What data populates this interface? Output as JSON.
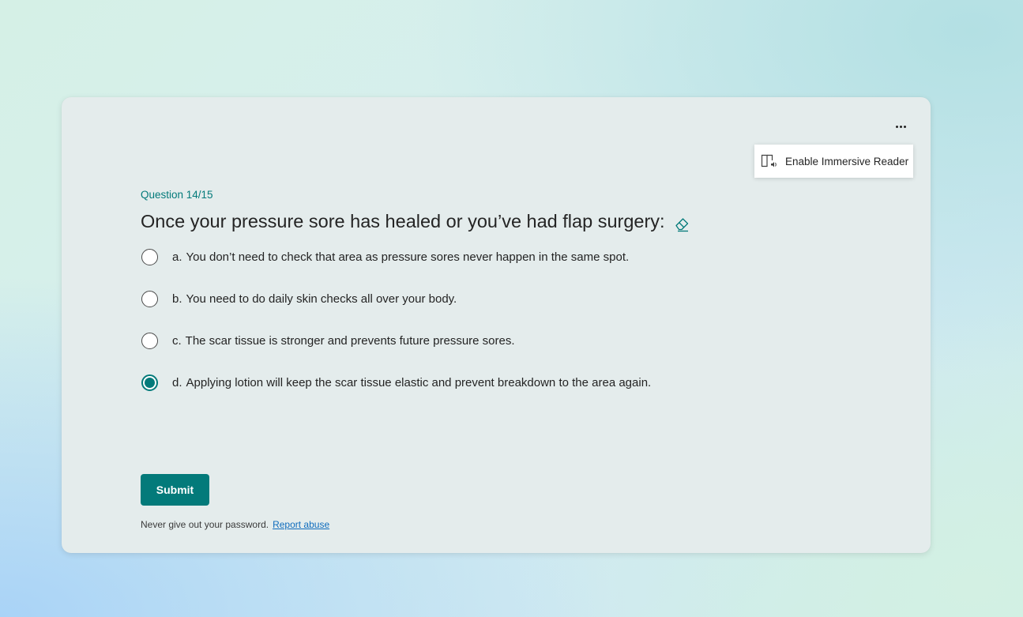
{
  "menu": {
    "more_icon": "more-horizontal-icon"
  },
  "immersive_reader": {
    "label": "Enable Immersive Reader",
    "icon": "immersive-reader-icon"
  },
  "question": {
    "number": "Question 14/15",
    "title": "Once your pressure sore has healed or you’ve had flap surgery:",
    "title_icon": "eraser-icon",
    "options": [
      {
        "letter": "a.",
        "text": "You don’t need to check that area as pressure sores never happen in the same spot.",
        "selected": false
      },
      {
        "letter": "b.",
        "text": "You need to do daily skin checks all over your body.",
        "selected": false
      },
      {
        "letter": "c.",
        "text": "The scar tissue is stronger and prevents future pressure sores.",
        "selected": false
      },
      {
        "letter": "d.",
        "text": "Applying lotion will keep the scar tissue elastic and prevent breakdown to the area again.",
        "selected": true
      }
    ]
  },
  "submit": {
    "label": "Submit"
  },
  "footer": {
    "text": "Never give out your password.",
    "link": "Report abuse"
  },
  "colors": {
    "accent": "#037a7a",
    "link": "#0f6cbd",
    "card": "#e4ecec"
  }
}
